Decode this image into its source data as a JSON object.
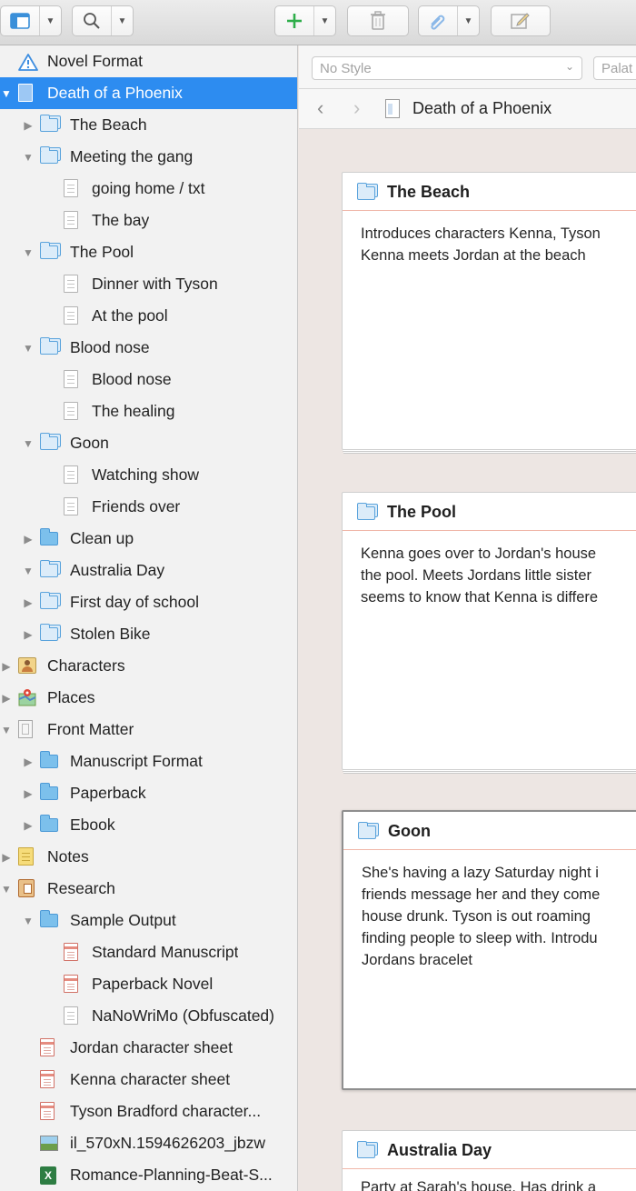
{
  "toolbar": {
    "buttons": [
      {
        "name": "view-mode-button",
        "icon": "layout-icon",
        "has_menu": true
      },
      {
        "name": "search-button",
        "icon": "magnifier-icon",
        "has_menu": true
      },
      {
        "name": "add-button",
        "icon": "plus-icon",
        "has_menu": true
      },
      {
        "name": "delete-button",
        "icon": "trash-icon",
        "has_menu": false
      },
      {
        "name": "attach-button",
        "icon": "paperclip-icon",
        "has_menu": true
      },
      {
        "name": "compose-button",
        "icon": "compose-icon",
        "has_menu": false
      }
    ]
  },
  "binder": {
    "items": [
      {
        "label": "Novel Format",
        "level": 0,
        "expander": "none",
        "icon": "warning-icon"
      },
      {
        "label": "Death of a Phoenix",
        "level": 0,
        "expander": "open",
        "icon": "document-icon",
        "selected": true
      },
      {
        "label": "The Beach",
        "level": 1,
        "expander": "closed",
        "icon": "folder-stack-icon"
      },
      {
        "label": "Meeting the gang",
        "level": 1,
        "expander": "open",
        "icon": "folder-stack-icon"
      },
      {
        "label": "going home / txt",
        "level": 2,
        "expander": "none",
        "icon": "text-document-icon"
      },
      {
        "label": "The bay",
        "level": 2,
        "expander": "none",
        "icon": "text-document-icon"
      },
      {
        "label": "The Pool",
        "level": 1,
        "expander": "open",
        "icon": "folder-stack-icon"
      },
      {
        "label": "Dinner with Tyson",
        "level": 2,
        "expander": "none",
        "icon": "text-document-icon"
      },
      {
        "label": "At the pool",
        "level": 2,
        "expander": "none",
        "icon": "text-document-icon"
      },
      {
        "label": "Blood nose",
        "level": 1,
        "expander": "open",
        "icon": "folder-stack-icon"
      },
      {
        "label": "Blood nose",
        "level": 2,
        "expander": "none",
        "icon": "text-document-icon"
      },
      {
        "label": "The healing",
        "level": 2,
        "expander": "none",
        "icon": "text-document-icon"
      },
      {
        "label": "Goon",
        "level": 1,
        "expander": "open",
        "icon": "folder-stack-icon"
      },
      {
        "label": "Watching show",
        "level": 2,
        "expander": "none",
        "icon": "text-document-icon"
      },
      {
        "label": "Friends over",
        "level": 2,
        "expander": "none",
        "icon": "text-document-icon"
      },
      {
        "label": "Clean up",
        "level": 1,
        "expander": "closed",
        "icon": "folder-icon"
      },
      {
        "label": "Australia Day",
        "level": 1,
        "expander": "open",
        "icon": "folder-stack-icon"
      },
      {
        "label": "First day of school",
        "level": 1,
        "expander": "closed",
        "icon": "folder-stack-icon"
      },
      {
        "label": "Stolen Bike",
        "level": 1,
        "expander": "closed",
        "icon": "folder-stack-icon"
      },
      {
        "label": "Characters",
        "level": 0,
        "expander": "closed",
        "icon": "characters-icon"
      },
      {
        "label": "Places",
        "level": 0,
        "expander": "closed",
        "icon": "places-icon"
      },
      {
        "label": "Front Matter",
        "level": 0,
        "expander": "open",
        "icon": "front-matter-icon"
      },
      {
        "label": "Manuscript Format",
        "level": 1,
        "expander": "closed",
        "icon": "folder-icon"
      },
      {
        "label": "Paperback",
        "level": 1,
        "expander": "closed",
        "icon": "folder-icon"
      },
      {
        "label": "Ebook",
        "level": 1,
        "expander": "closed",
        "icon": "folder-icon"
      },
      {
        "label": "Notes",
        "level": 0,
        "expander": "closed",
        "icon": "notes-icon"
      },
      {
        "label": "Research",
        "level": 0,
        "expander": "open",
        "icon": "research-icon"
      },
      {
        "label": "Sample Output",
        "level": 1,
        "expander": "open",
        "icon": "folder-icon"
      },
      {
        "label": "Standard Manuscript",
        "level": 2,
        "expander": "none",
        "icon": "pdf-sheet-icon"
      },
      {
        "label": "Paperback Novel",
        "level": 2,
        "expander": "none",
        "icon": "pdf-sheet-icon"
      },
      {
        "label": "NaNoWriMo (Obfuscated)",
        "level": 2,
        "expander": "none",
        "icon": "text-document-icon"
      },
      {
        "label": "Jordan character sheet",
        "level": 1,
        "expander": "none",
        "icon": "pdf-sheet-icon"
      },
      {
        "label": "Kenna character sheet",
        "level": 1,
        "expander": "none",
        "icon": "pdf-sheet-icon"
      },
      {
        "label": "Tyson Bradford character...",
        "level": 1,
        "expander": "none",
        "icon": "pdf-sheet-icon"
      },
      {
        "label": "il_570xN.1594626203_jbzw",
        "level": 1,
        "expander": "none",
        "icon": "image-icon"
      },
      {
        "label": "Romance-Planning-Beat-S...",
        "level": 1,
        "expander": "none",
        "icon": "spreadsheet-icon"
      }
    ]
  },
  "format_bar": {
    "style_select": "No Style",
    "font_select": "Palat"
  },
  "nav": {
    "doc_title": "Death of a Phoenix"
  },
  "corkboard": {
    "cards": [
      {
        "title": "The Beach",
        "synopsis": "Introduces characters Kenna, Tyson\nKenna meets Jordan at the beach",
        "active": false
      },
      {
        "title": "The Pool",
        "synopsis": "Kenna goes over to Jordan's house\nthe pool. Meets Jordans little sister\nseems to know that Kenna is differe",
        "active": false
      },
      {
        "title": "Goon",
        "synopsis": "She's having a lazy Saturday night i\nfriends message her and they come\nhouse drunk. Tyson is out roaming\nfinding people to sleep with. Introdu\nJordans bracelet",
        "active": true
      },
      {
        "title": "Australia Day",
        "synopsis": "Party at Sarah's house. Has drink a",
        "active": false
      }
    ]
  },
  "colors": {
    "selection": "#2d8cf0",
    "folder_blue": "#5aa3dc",
    "card_header_rule": "#f0b7a9",
    "editor_background": "#ede6e3"
  }
}
